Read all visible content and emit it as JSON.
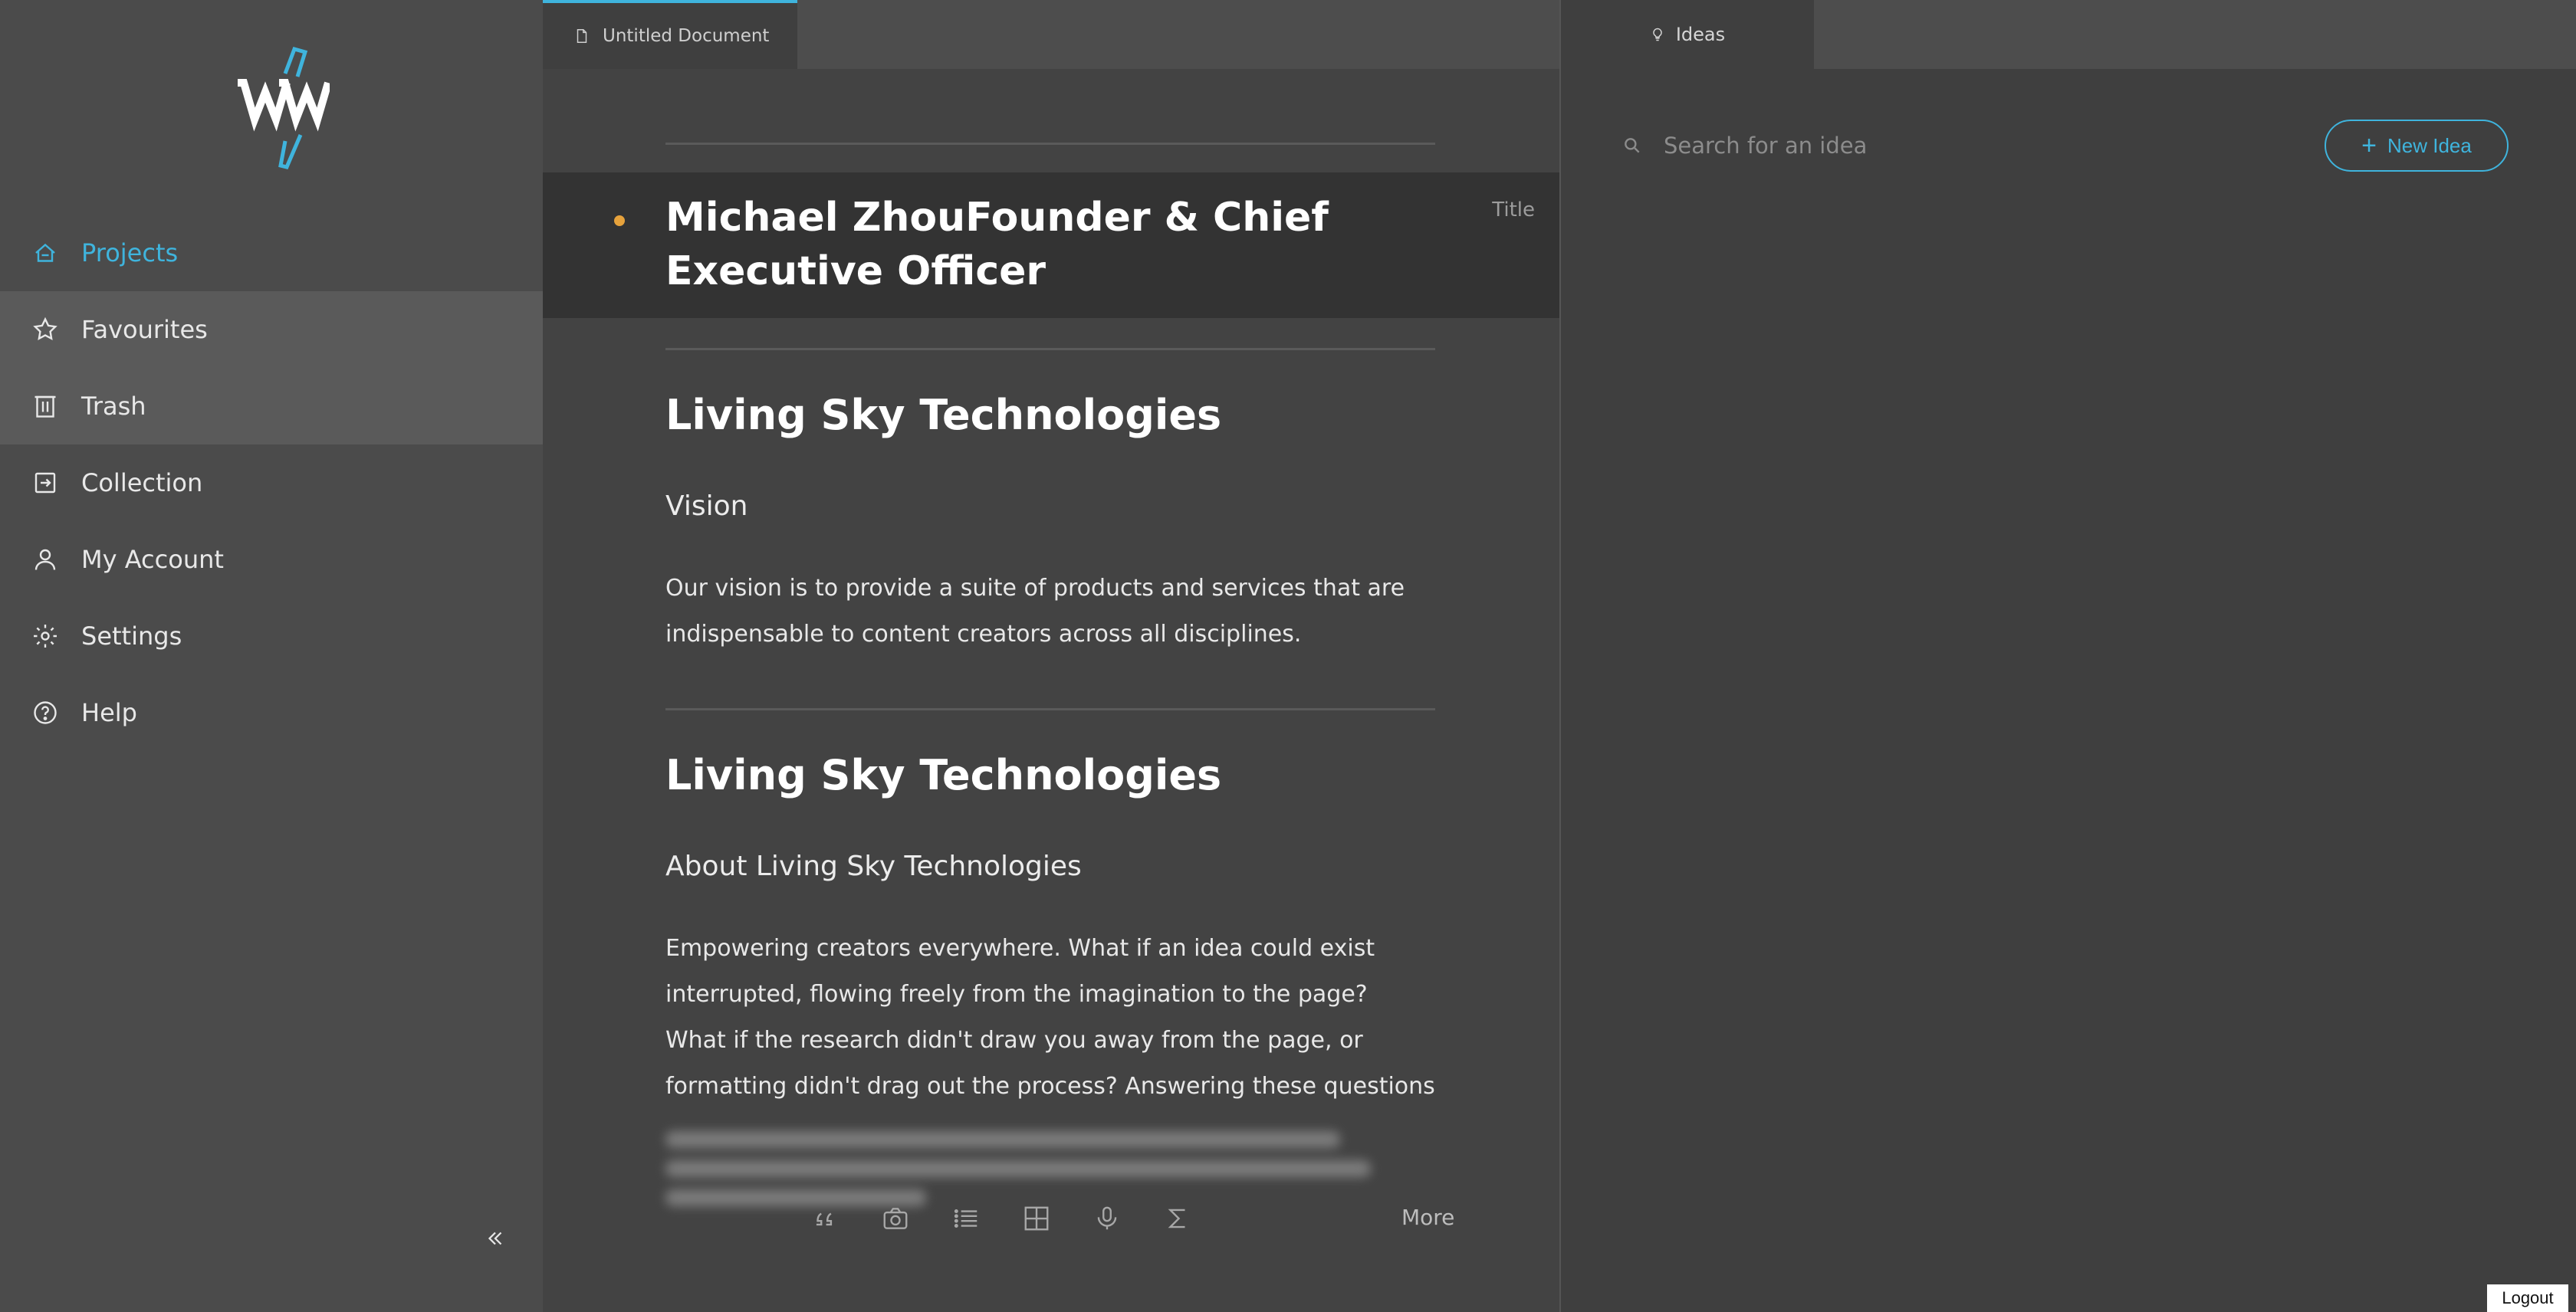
{
  "sidebar": {
    "items": [
      {
        "label": "Projects",
        "icon": "projects-icon"
      },
      {
        "label": "Favourites",
        "icon": "star-icon"
      },
      {
        "label": "Trash",
        "icon": "trash-icon"
      },
      {
        "label": "Collection",
        "icon": "collection-icon"
      },
      {
        "label": "My Account",
        "icon": "user-icon"
      },
      {
        "label": "Settings",
        "icon": "gear-icon"
      },
      {
        "label": "Help",
        "icon": "help-icon"
      }
    ],
    "collapse_icon": "double-chevron-left-icon"
  },
  "editor": {
    "tab_label": "Untitled Document",
    "title": "Michael ZhouFounder & Chief Executive Officer",
    "title_tag": "Title",
    "sections": [
      {
        "heading": "Living Sky Technologies",
        "subheading": "Vision",
        "text": "Our vision is to provide a suite of products and services that are indispensable to content creators across all disciplines."
      },
      {
        "heading": "Living Sky Technologies",
        "subheading": "About Living Sky Technologies",
        "text": "Empowering creators everywhere. What if an idea could exist interrupted, flowing freely from the imagination to the page? What if the research didn't draw you away from the page, or formatting didn't drag out the process? Answering these questions has led the"
      }
    ],
    "toolbar": {
      "icons": [
        "quote-icon",
        "camera-icon",
        "list-icon",
        "table-icon",
        "microphone-icon",
        "sigma-icon"
      ],
      "more_label": "More"
    }
  },
  "ideas": {
    "tab_label": "Ideas",
    "search_placeholder": "Search for an idea",
    "new_idea_label": "New Idea"
  },
  "logout_label": "Logout",
  "colors": {
    "accent": "#3fb4dd",
    "title_dot": "#e6a23c"
  }
}
